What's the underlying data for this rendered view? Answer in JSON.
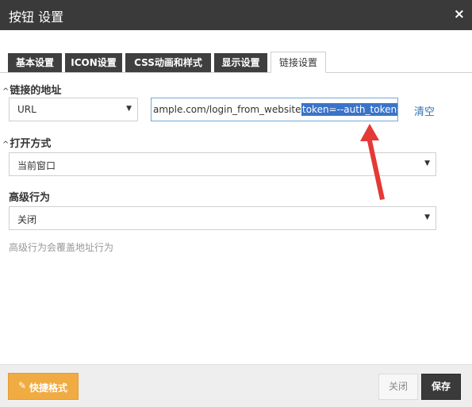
{
  "dialog": {
    "title": "按钮 设置",
    "close_glyph": "×"
  },
  "tabs": [
    {
      "label": "基本设置",
      "active": false
    },
    {
      "label": "ICON设置",
      "active": false
    },
    {
      "label": "CSS动画和样式",
      "active": false
    },
    {
      "label": "显示设置",
      "active": false
    },
    {
      "label": "链接设置",
      "active": true
    }
  ],
  "link_section": {
    "label": "链接的地址",
    "type_select_value": "URL",
    "url_visible_text": "ample.com/login_from_website?",
    "url_selected_text": "token=--auth_token--",
    "clear_label": "清空"
  },
  "open_section": {
    "label": "打开方式",
    "value": "当前窗口"
  },
  "advanced_section": {
    "label": "高级行为",
    "value": "关闭",
    "hint": "高级行为会覆盖地址行为"
  },
  "footer": {
    "quick_label": "快捷格式",
    "close_label": "关闭",
    "save_label": "保存"
  },
  "colors": {
    "title_bar": "#3a3a3a",
    "quick_button": "#f0ab43",
    "selection": "#3a73c9",
    "annotation_arrow": "#e53935",
    "link": "#2f73b8"
  },
  "icons": {
    "caret": "caret-up-icon",
    "dropdown": "dropdown-arrow-icon",
    "quick": "pen-icon",
    "close": "close-icon"
  }
}
